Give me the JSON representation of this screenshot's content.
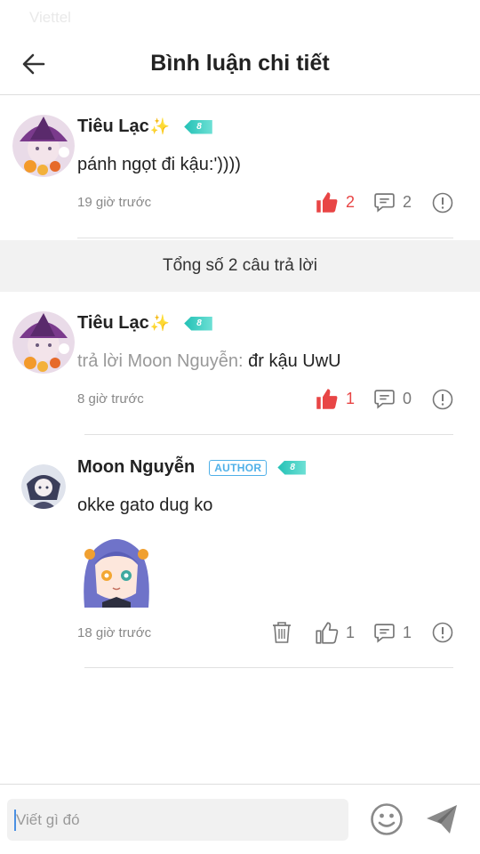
{
  "status_bar": {
    "carrier": "Viettel"
  },
  "header": {
    "title": "Bình luận chi tiết"
  },
  "main_comment": {
    "username": "Tiêu Lạc",
    "sparkle": "✨",
    "level": "8",
    "text": "pánh ngọt đi kậu:'))))",
    "time": "19 giờ trước",
    "likes": "2",
    "replies": "2"
  },
  "reply_summary": "Tổng số 2 câu trả lời",
  "replies": [
    {
      "username": "Tiêu Lạc",
      "sparkle": "✨",
      "level": "8",
      "reply_prefix": "trả lời Moon Nguyễn:",
      "text": "đr kậu UwU",
      "time": "8 giờ trước",
      "likes": "1",
      "replies": "0"
    },
    {
      "username": "Moon Nguyễn",
      "author_badge": "AUTHOR",
      "level": "8",
      "text": "okke gato dug ko",
      "time": "18 giờ trước",
      "likes": "1",
      "replies": "1"
    }
  ],
  "composer": {
    "placeholder": "Viết gì đó"
  },
  "colors": {
    "like_active": "#e84545",
    "level_badge": "#22c1b5",
    "author_badge": "#4fb0e8"
  },
  "icons": [
    "back-arrow-icon",
    "thumbs-up-icon",
    "comment-icon",
    "report-icon",
    "trash-icon",
    "emoji-icon",
    "send-icon"
  ]
}
